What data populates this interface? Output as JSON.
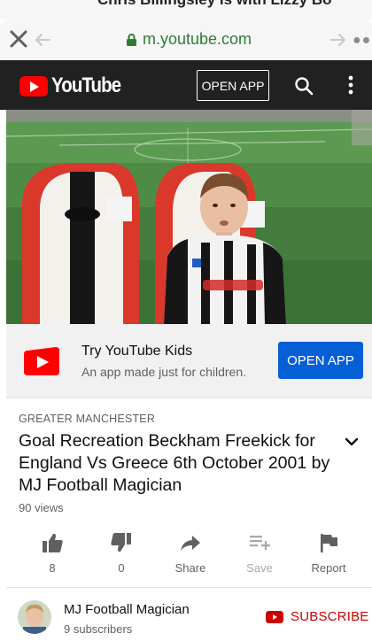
{
  "notification": {
    "text": "Chris Billingsley is with Lizzy Bo"
  },
  "browser": {
    "url": "m.youtube.com"
  },
  "header": {
    "logo_text": "YouTube",
    "open_app_label": "OPEN APP"
  },
  "promo": {
    "title": "Try YouTube Kids",
    "subtitle": "An app made just for children.",
    "button_label": "OPEN APP"
  },
  "video": {
    "location": "GREATER MANCHESTER",
    "title": "Goal Recreation Beckham Freekick for England Vs Greece 6th October 2001 by MJ Football Magician",
    "views": "90 views"
  },
  "actions": {
    "like_count": "8",
    "dislike_count": "0",
    "share_label": "Share",
    "save_label": "Save",
    "report_label": "Report"
  },
  "channel": {
    "name": "MJ Football Magician",
    "subscribers": "9 subscribers",
    "subscribe_label": "SUBSCRIBE"
  },
  "colors": {
    "brand_red": "#ff0000",
    "subscribe_red": "#cc0000",
    "accent_blue": "#065fd4",
    "header_bg": "#212121",
    "url_green": "#2e7d32"
  },
  "icons": [
    "close-icon",
    "back-icon",
    "lock-icon",
    "forward-icon",
    "more-icon",
    "search-icon",
    "kebab-icon",
    "youtube-kids-icon",
    "chevron-down-icon",
    "thumbs-up-icon",
    "thumbs-down-icon",
    "share-icon",
    "save-playlist-icon",
    "flag-icon",
    "youtube-play-icon"
  ]
}
